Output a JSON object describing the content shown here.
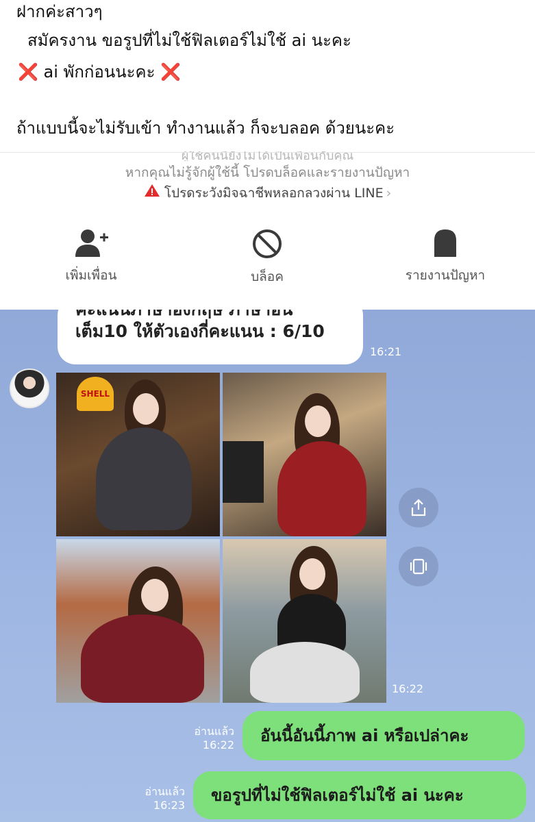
{
  "caption": {
    "line1": "ฝากค่ะสาวๆ",
    "line2": "สมัครงาน ขอรูปที่ไม่ใช้ฟิลเตอร์ไม่ใช้ ai นะคะ",
    "line3_left_icon": "❌",
    "line3": "ai พักก่อนนะคะ",
    "line3_right_icon": "❌",
    "line4": "ถ้าแบบนี้จะไม่รับเข้า ทำงานแล้ว ก็จะบลอค ด้วยนะคะ"
  },
  "notice": {
    "faded_text": "ผู้ใช้คนนี้ยังไม่ได้เป็นเพื่อนกับคุณ",
    "info": "หากคุณไม่รู้จักผู้ใช้นี้ โปรดบล็อคและรายงานปัญหา",
    "warning_icon": "warning-triangle-icon",
    "warning": "โปรดระวังมิจฉาชีพหลอกลวงผ่าน LINE",
    "chevron": "›",
    "actions": [
      {
        "label": "เพิ่มเพื่อน",
        "icon": "add-friend-icon"
      },
      {
        "label": "บล็อค",
        "icon": "block-icon"
      },
      {
        "label": "รายงานปัญหา",
        "icon": "report-icon"
      }
    ]
  },
  "chat": {
    "incoming_text": {
      "line1": "คะแนนภาษาองกฤษ ภาษาอน",
      "line2": "เต็ม10 ให้ตัวเองกี่คะแนน : 6/10",
      "time": "16:21"
    },
    "photo_sign": "SHELL",
    "photos_time": "16:22",
    "outgoing": [
      {
        "read": "อ่านแล้ว",
        "time": "16:22",
        "text": "อันนี้อันนี้ภาพ ai หรือเปล่าคะ"
      },
      {
        "read": "อ่านแล้ว",
        "time": "16:23",
        "text": "ขอรูปที่ไม่ใช้ฟิลเตอร์ไม่ใช้ ai นะคะ"
      }
    ],
    "colors": {
      "background": "#9db5e2",
      "outgoing_bubble": "#7ee07a",
      "incoming_bubble": "#ffffff"
    }
  }
}
